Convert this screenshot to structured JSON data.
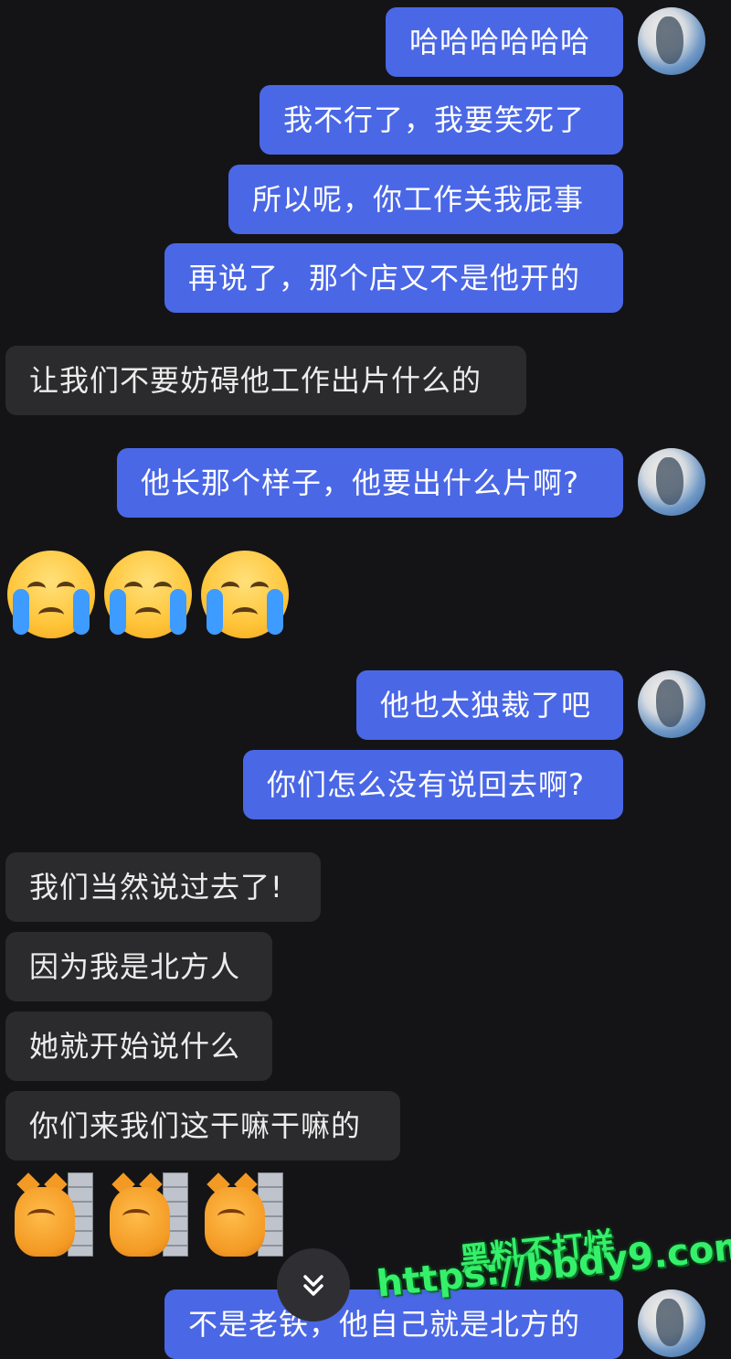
{
  "messages": [
    {
      "side": "sent",
      "text": "哈哈哈哈哈哈"
    },
    {
      "side": "sent",
      "text": "我不行了，我要笑死了"
    },
    {
      "side": "sent",
      "text": "所以呢，你工作关我屁事"
    },
    {
      "side": "sent",
      "text": "再说了，那个店又不是他开的"
    },
    {
      "side": "recv",
      "text": "让我们不要妨碍他工作出片什么的"
    },
    {
      "side": "sent",
      "text": "他长那个样子，他要出什么片啊?"
    },
    {
      "side": "sent",
      "text": "他也太独裁了吧"
    },
    {
      "side": "sent",
      "text": "你们怎么没有说回去啊?"
    },
    {
      "side": "recv",
      "text": "我们当然说过去了!"
    },
    {
      "side": "recv",
      "text": "因为我是北方人"
    },
    {
      "side": "recv",
      "text": "她就开始说什么"
    },
    {
      "side": "recv",
      "text": "你们来我们这干嘛干嘛的"
    },
    {
      "side": "sent",
      "text": "不是老铁，他自己就是北方的"
    }
  ],
  "stickers": {
    "crying": [
      "loudly-crying-face-icon",
      "loudly-crying-face-icon",
      "loudly-crying-face-icon"
    ],
    "cats": [
      "cat-behind-wall-icon",
      "cat-behind-wall-icon",
      "cat-behind-wall-icon"
    ]
  },
  "scroll_button": {
    "icon": "double-chevron-down-icon"
  },
  "watermark": {
    "line1": "黑料不打烊",
    "line2": "https://bbdy9.com"
  },
  "colors": {
    "sent": "#4a67e6",
    "received": "#2b2b2d",
    "background": "#141416",
    "watermark": "#35f06a"
  }
}
